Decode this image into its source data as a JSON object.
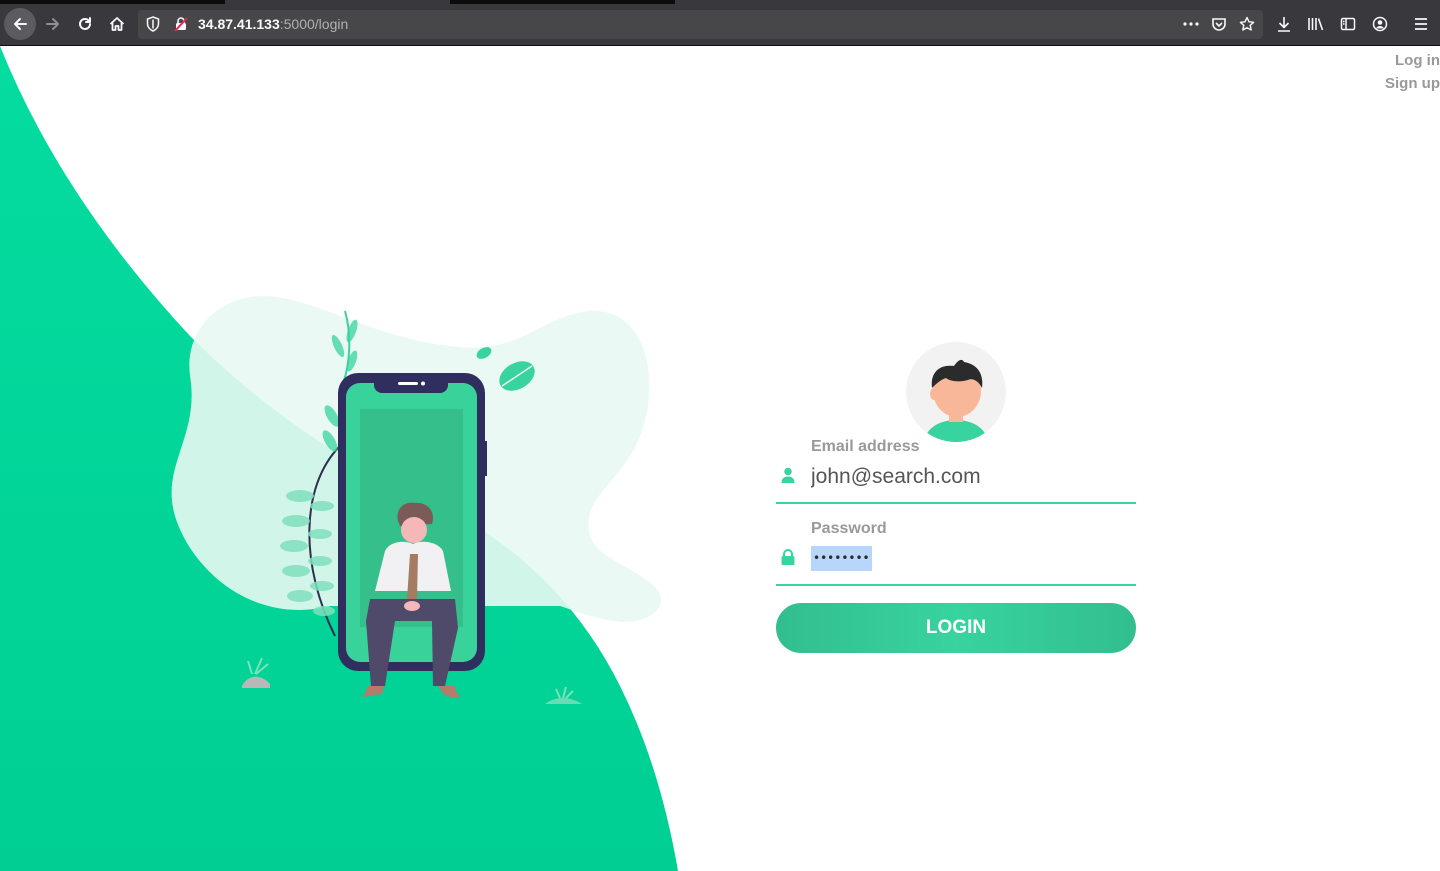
{
  "browser": {
    "url_host": "34.87.41.133",
    "url_path": ":5000/login"
  },
  "nav": {
    "login_link": "Log in",
    "signup_link": "Sign up"
  },
  "form": {
    "email_label": "Email address",
    "email_value": "john@search.com",
    "password_label": "Password",
    "password_mask": "••••••••",
    "submit_label": "LOGIN"
  },
  "colors": {
    "accent": "#38d39f",
    "accent_dark": "#32be8f",
    "wave_green": "#05d99b",
    "label_gray": "#999999"
  }
}
